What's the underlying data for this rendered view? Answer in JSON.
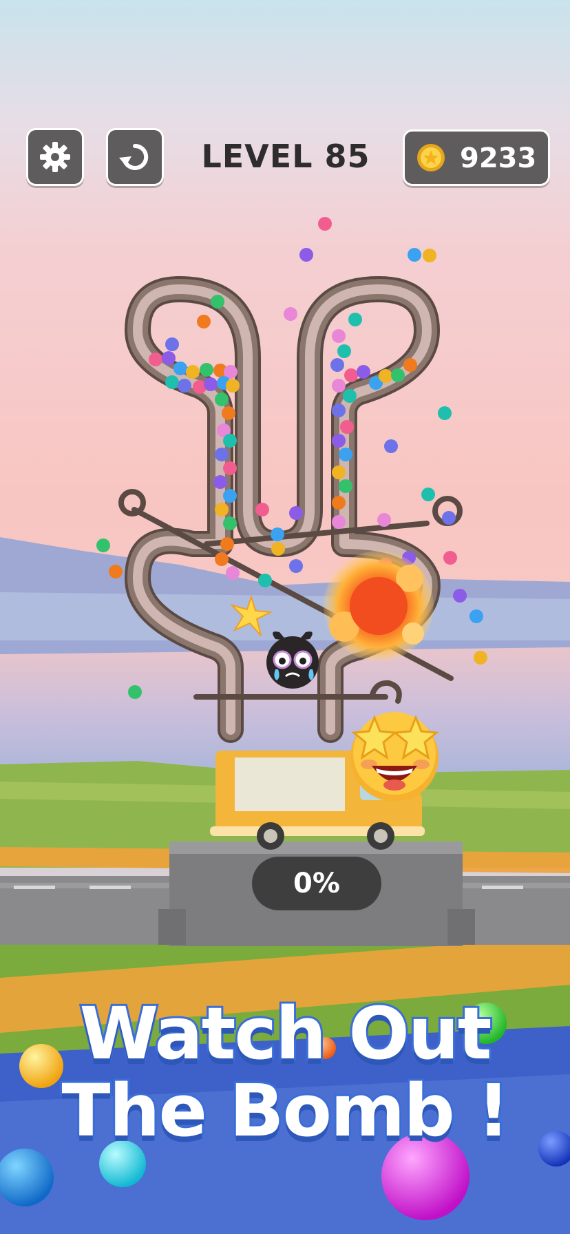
{
  "hud": {
    "settings_icon": "gear-icon",
    "restart_icon": "restart-icon",
    "level_title": "LEVEL 85",
    "coin_icon": "coin-icon",
    "coin_count": "9233"
  },
  "progress": {
    "label": "0%",
    "value": 0
  },
  "headline": {
    "line1": "Watch Out",
    "line2": "The Bomb !"
  },
  "colors": {
    "hud_button": "#5f5c5d",
    "title": "#2e2c2d",
    "headline_fill": "#ffffff",
    "headline_outline": "#3a6ed8",
    "pipe": "#6e5a51",
    "truck": "#f3b53a",
    "bomb": "#2a2526"
  }
}
